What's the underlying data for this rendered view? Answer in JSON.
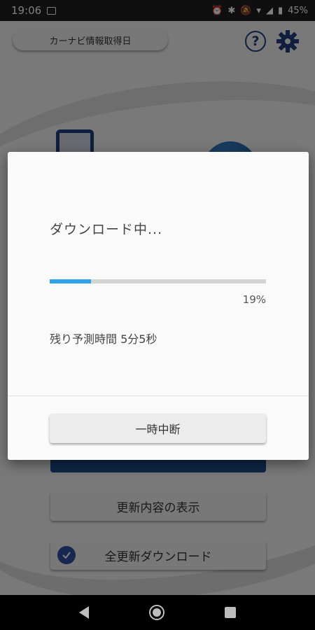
{
  "status_bar": {
    "time": "19:06",
    "battery": "45%",
    "icons": [
      "image-icon",
      "alarm-icon",
      "bluetooth-icon",
      "mute-icon",
      "wifi-icon",
      "signal-icon",
      "battery-icon"
    ]
  },
  "app": {
    "date_button_label": "カーナビ情報取得日",
    "help_icon_glyph": "?",
    "update_content_button": "更新内容の表示",
    "full_update_download_button": "全更新ダウンロード",
    "accent_color": "#1b4f8c"
  },
  "dialog": {
    "title": "ダウンロード中...",
    "progress": {
      "percent_label": "19%",
      "value": 0.19,
      "color": "#2ea3e5"
    },
    "remaining_time": "残り予測時間 5分5秒",
    "pause_button_label": "一時中断"
  },
  "nav_bar": {
    "buttons": [
      "back-icon",
      "home-icon",
      "recents-icon"
    ]
  }
}
